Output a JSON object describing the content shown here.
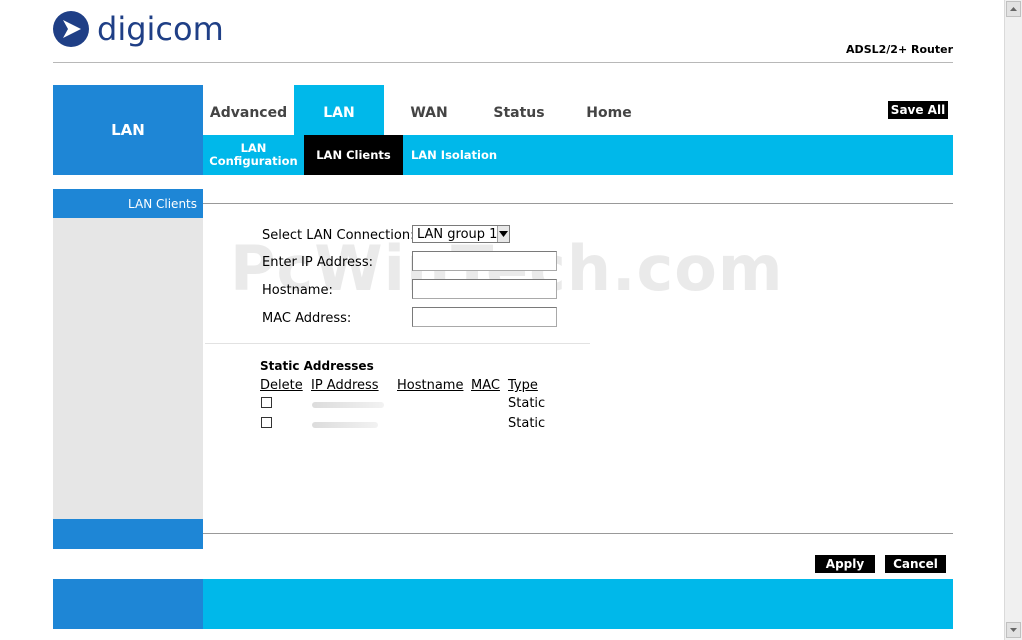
{
  "brand": {
    "name": "digicom",
    "product": "ADSL2/2+ Router"
  },
  "section_title": "LAN",
  "tabs": [
    {
      "label": "Advanced",
      "active": false
    },
    {
      "label": "LAN",
      "active": true
    },
    {
      "label": "WAN",
      "active": false
    },
    {
      "label": "Status",
      "active": false
    },
    {
      "label": "Home",
      "active": false
    }
  ],
  "save_all": "Save All",
  "subtabs": [
    {
      "label": "LAN\nConfiguration",
      "active": false
    },
    {
      "label": "LAN Clients",
      "active": true
    },
    {
      "label": "LAN Isolation",
      "active": false
    }
  ],
  "sidebar": {
    "heading": "LAN Clients"
  },
  "form": {
    "select_label": "Select LAN Connection:",
    "select_value": "LAN group 1",
    "ip_label": "Enter IP Address:",
    "ip_value": "",
    "hostname_label": "Hostname:",
    "hostname_value": "",
    "mac_label": "MAC Address:",
    "mac_value": ""
  },
  "static": {
    "title": "Static Addresses",
    "columns": [
      "Delete",
      "IP Address",
      "Hostname",
      "MAC",
      "Type"
    ],
    "rows": [
      {
        "type": "Static"
      },
      {
        "type": "Static"
      }
    ]
  },
  "watermark": "PcWinTech.com",
  "buttons": {
    "apply": "Apply",
    "cancel": "Cancel"
  },
  "colors": {
    "primary": "#1e86d6",
    "accent": "#00b8ea",
    "brand": "#1f3f86"
  },
  "icons": {
    "logo": "digicom-arrow-logo",
    "dropdown": "triangle-down-icon"
  }
}
